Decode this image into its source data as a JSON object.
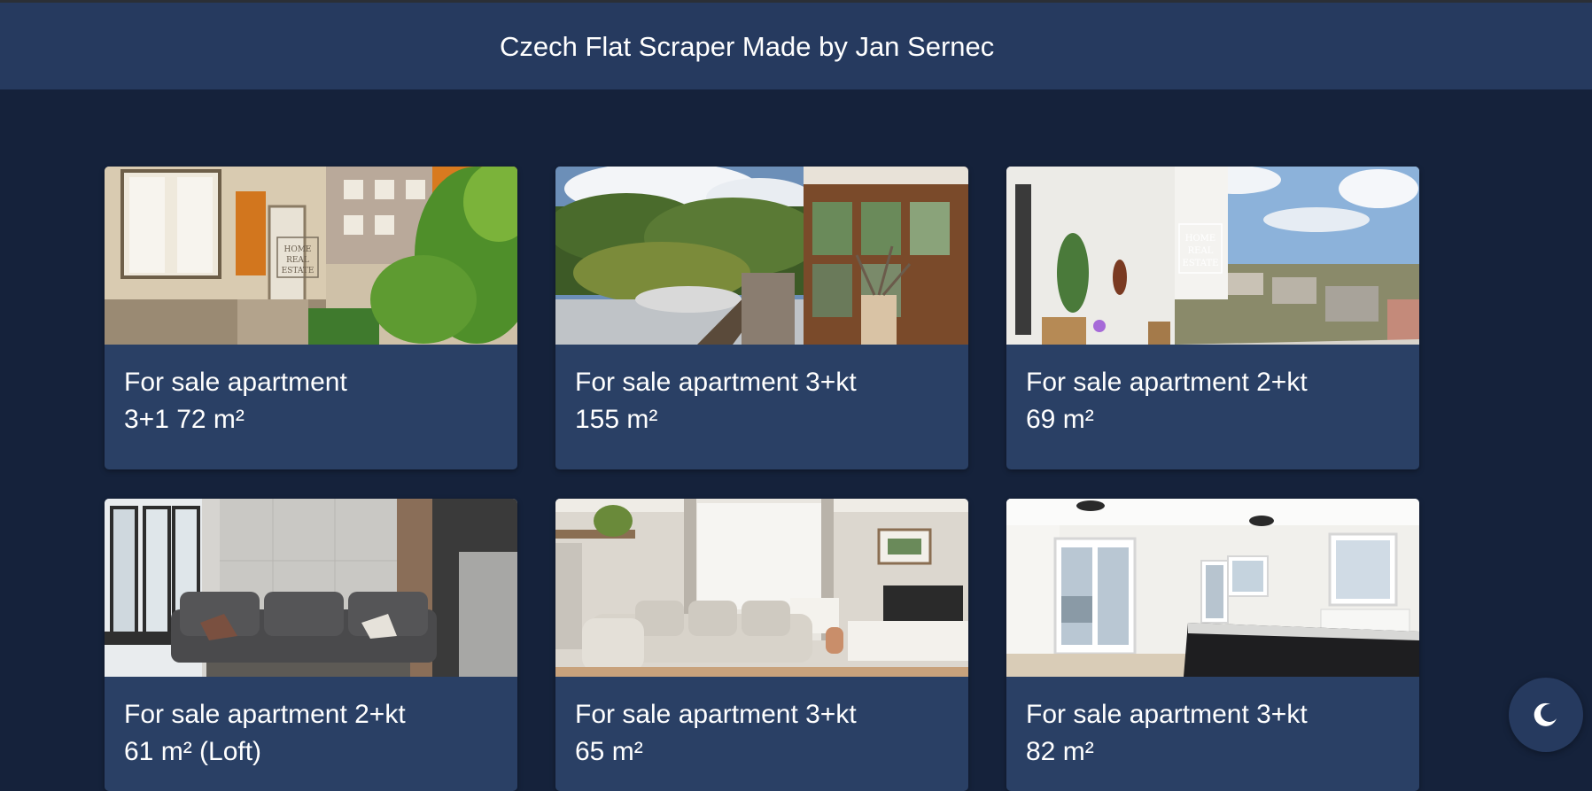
{
  "header": {
    "title": "Czech Flat Scraper Made by Jan Sernec"
  },
  "listings": [
    {
      "line1": "For sale apartment",
      "line2": "3+1 72 m²",
      "photo": "apartment-exterior-garden",
      "watermark": "HOME REAL ESTATE"
    },
    {
      "line1": "For sale apartment 3+kt",
      "line2": "155 m²",
      "photo": "balcony-forest-view"
    },
    {
      "line1": "For sale apartment 2+kt",
      "line2": "69 m²",
      "photo": "balcony-city-view",
      "watermark": "HOME REAL ESTATE"
    },
    {
      "line1": "For sale apartment 2+kt",
      "line2": "61 m² (Loft)",
      "photo": "loft-living-room-stairs"
    },
    {
      "line1": "For sale apartment 3+kt",
      "line2": "65 m²",
      "photo": "living-room-sofa-tv"
    },
    {
      "line1": "For sale apartment 3+kt",
      "line2": "82 m²",
      "photo": "bright-room-kitchen-island"
    }
  ],
  "theme_toggle": {
    "icon": "moon-icon"
  },
  "colors": {
    "background": "#15223b",
    "header": "#263a5f",
    "card": "#2a4065",
    "text": "#ffffff"
  }
}
